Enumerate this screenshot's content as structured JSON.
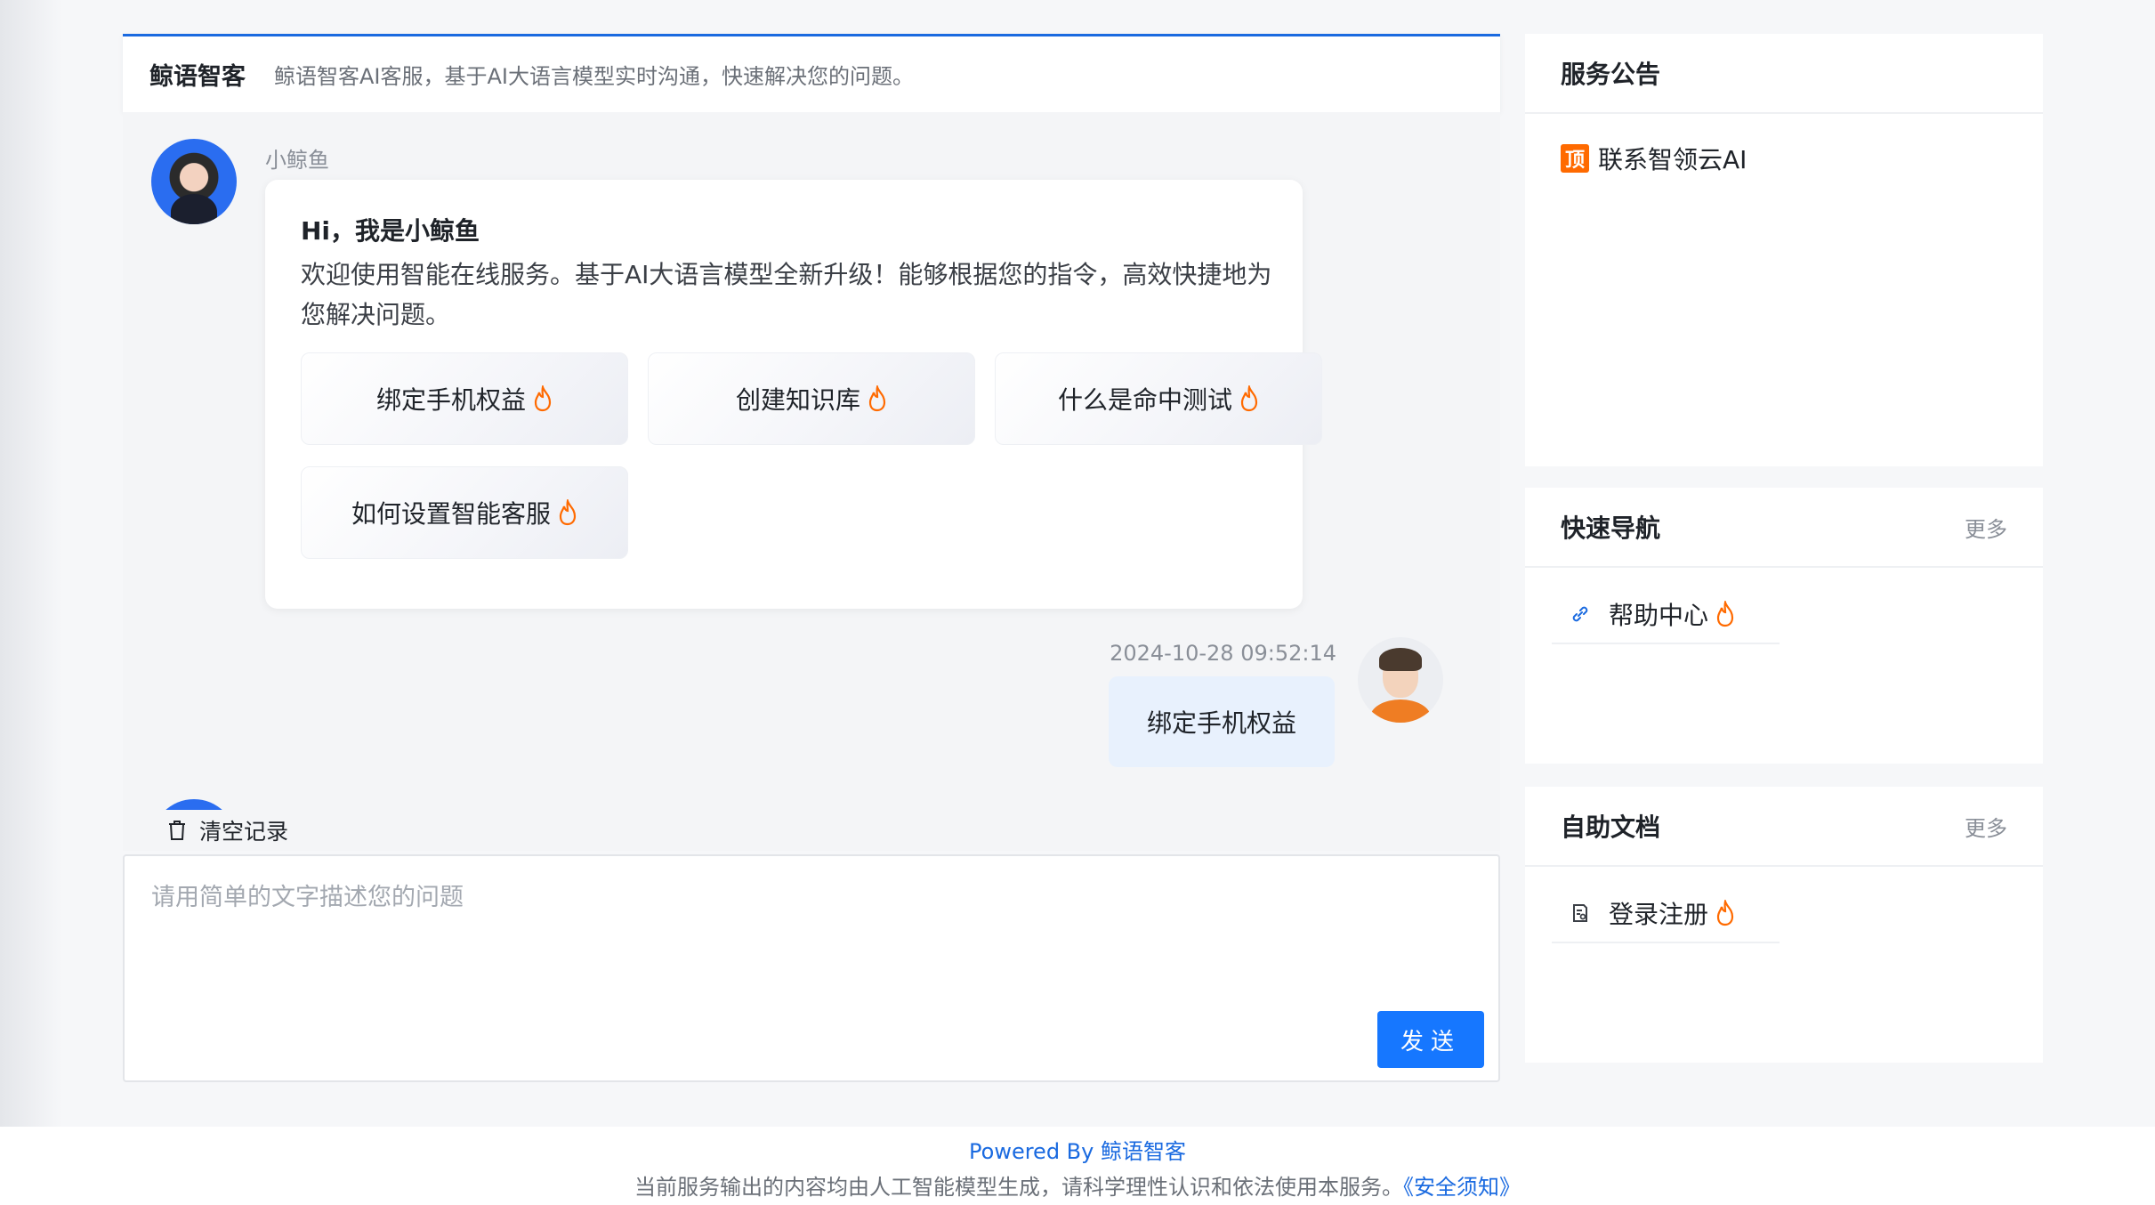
{
  "header": {
    "brand": "鲸语智客",
    "subtitle": "鲸语智客AI客服，基于AI大语言模型实时沟通，快速解决您的问题。"
  },
  "chat": {
    "bot_name": "小鲸鱼",
    "greeting": "Hi，我是小鲸鱼",
    "intro": "欢迎使用智能在线服务。基于AI大语言模型全新升级！能够根据您的指令，高效快捷地为您解决问题。",
    "quick_questions": [
      "绑定手机权益",
      "创建知识库",
      "什么是命中测试",
      "如何设置智能客服"
    ],
    "user_message": {
      "time": "2024-10-28 09:52:14",
      "text": "绑定手机权益"
    },
    "clear_label": "清空记录"
  },
  "input": {
    "placeholder": "请用简单的文字描述您的问题",
    "send_label": "发送"
  },
  "sidebar": {
    "notice": {
      "title": "服务公告",
      "badge": "顶",
      "item": "联系智领云AI"
    },
    "nav": {
      "title": "快速导航",
      "more": "更多",
      "item": "帮助中心"
    },
    "docs": {
      "title": "自助文档",
      "more": "更多",
      "item": "登录注册"
    }
  },
  "footer": {
    "powered_prefix": "Powered By ",
    "powered_brand": "鲸语智客",
    "disclaimer": "当前服务输出的内容均由人工智能模型生成，请科学理性认识和依法使用本服务。",
    "safety_link": "《安全须知》"
  },
  "colors": {
    "accent": "#1677ff",
    "fire": "#ff6a00"
  }
}
